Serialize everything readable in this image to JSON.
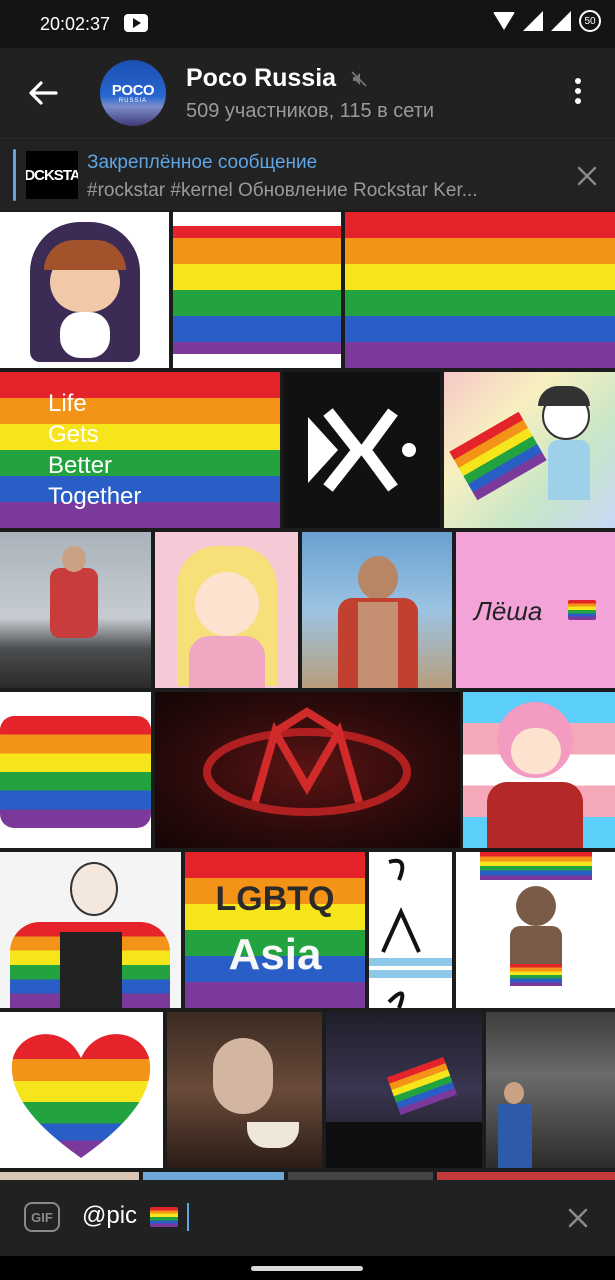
{
  "status_bar": {
    "time": "20:02:37",
    "battery": "50"
  },
  "chat": {
    "title": "Poco Russia",
    "subtitle": "509 участников, 115 в сети",
    "avatar_text": "POCO",
    "avatar_subtext": "RUSSIA"
  },
  "pinned": {
    "thumb_text": "DCKSTA",
    "title": "Закреплённое сообщение",
    "text": "#rockstar #kernel Обновление Rockstar Ker..."
  },
  "results": {
    "life_lines": [
      "Life",
      "Gets",
      "Better",
      "Together"
    ],
    "lesha": "Лёша",
    "lgbtq": "LGBTQ",
    "asia": "Asia"
  },
  "input": {
    "value": "@pic",
    "gif_label": "GIF"
  },
  "icons": [
    "back-arrow-icon",
    "mute-icon",
    "more-vert-icon",
    "close-icon",
    "gif-icon",
    "rainbow-flag-emoji"
  ]
}
